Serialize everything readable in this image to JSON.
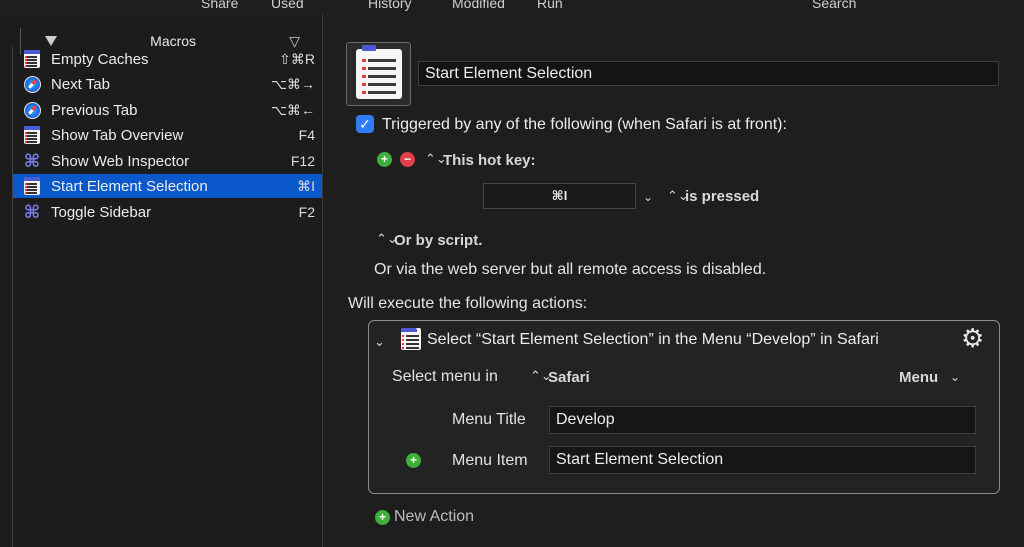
{
  "toolbar": {
    "labels": [
      "Share",
      "Used",
      "History",
      "Modified",
      "Run",
      "Search"
    ]
  },
  "macros_list": {
    "header": "Macros",
    "items": [
      {
        "name": "Empty Caches",
        "shortcut": "⇧⌘R",
        "icon": "list-icon"
      },
      {
        "name": "Next Tab",
        "shortcut": "⌥⌘→",
        "icon": "safari-icon"
      },
      {
        "name": "Previous Tab",
        "shortcut": "⌥⌘←",
        "icon": "safari-icon"
      },
      {
        "name": "Show Tab Overview",
        "shortcut": "F4",
        "icon": "list-icon"
      },
      {
        "name": "Show Web Inspector",
        "shortcut": "F12",
        "icon": "command-icon"
      },
      {
        "name": "Start Element Selection",
        "shortcut": "⌘I",
        "icon": "list-icon",
        "selected": true
      },
      {
        "name": "Toggle Sidebar",
        "shortcut": "F2",
        "icon": "command-icon"
      }
    ]
  },
  "editor": {
    "macro_name": "Start Element Selection",
    "trigger_text": "Triggered by any of the following (when Safari is at front):",
    "hotkey_label": "This hot key:",
    "hotkey_value": "⌘I",
    "is_pressed": "is pressed",
    "or_by_script": "Or by script.",
    "web_server_text": "Or via the web server but all remote access is disabled.",
    "will_execute": "Will execute the following actions:",
    "new_action": "New Action"
  },
  "action": {
    "title": "Select “Start Element Selection” in the Menu “Develop” in Safari",
    "select_menu_in": "Select menu in",
    "app": "Safari",
    "menu_button": "Menu",
    "menu_title_label": "Menu Title",
    "menu_title_value": "Develop",
    "menu_item_label": "Menu Item",
    "menu_item_value": "Start Element Selection"
  },
  "colors": {
    "selection": "#0a58ca",
    "checkbox": "#2f7cf6",
    "add": "#3fae3a",
    "remove": "#e0404a"
  }
}
